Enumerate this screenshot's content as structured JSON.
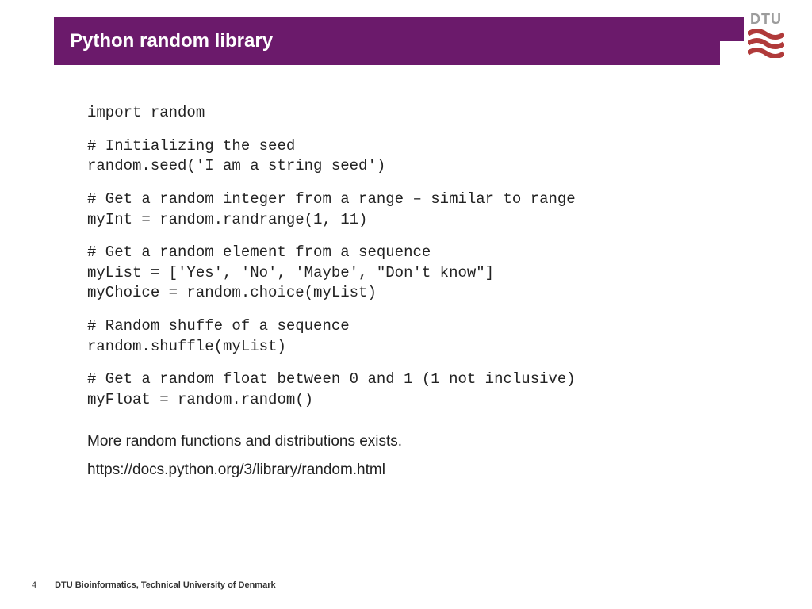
{
  "header": {
    "title": "Python random library"
  },
  "logo": {
    "text": "DTU"
  },
  "code": {
    "block1": "import random",
    "block2": "# Initializing the seed\nrandom.seed('I am a string seed')",
    "block3": "# Get a random integer from a range – similar to range\nmyInt = random.randrange(1, 11)",
    "block4": "# Get a random element from a sequence\nmyList = ['Yes', 'No', 'Maybe', \"Don't know\"]\nmyChoice = random.choice(myList)",
    "block5": "# Random shuffe of a sequence\nrandom.shuffle(myList)",
    "block6": "# Get a random float between 0 and 1 (1 not inclusive)\nmyFloat = random.random()"
  },
  "body": {
    "line1": "More random functions and distributions exists.",
    "line2": "https://docs.python.org/3/library/random.html"
  },
  "footer": {
    "page": "4",
    "text": "DTU Bioinformatics, Technical University of Denmark"
  }
}
